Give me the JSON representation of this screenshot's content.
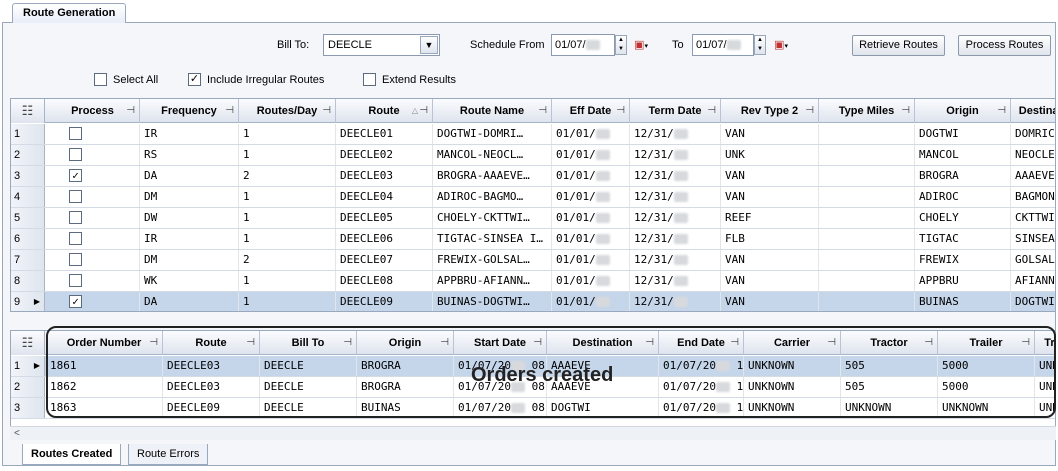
{
  "window": {
    "tab_title": "Route Generation"
  },
  "toolbar": {
    "bill_to_label": "Bill To:",
    "bill_to_value": "DEECLE",
    "schedule_from_label": "Schedule From",
    "schedule_from_value": "01/07/",
    "to_label": "To",
    "to_value": "01/07/",
    "retrieve_label": "Retrieve Routes",
    "process_label": "Process Routes"
  },
  "options": {
    "select_all": "Select All",
    "include_irregular": "Include Irregular Routes",
    "extend_results": "Extend Results"
  },
  "routes_grid": {
    "headers": [
      "Process",
      "Frequency",
      "Routes/Day",
      "Route",
      "Route Name",
      "Eff Date",
      "Term Date",
      "Rev Type 2",
      "Type Miles",
      "Origin",
      "Destinat"
    ],
    "rows": [
      {
        "n": "1",
        "checked": false,
        "freq": "IR",
        "rpd": "1",
        "route": "DEECLE01",
        "name": "DOGTWI-DOMRI…",
        "eff": "01/01/",
        "term": "12/31/",
        "rev": "VAN",
        "miles": "",
        "origin": "DOGTWI",
        "dest": "DOMRIC"
      },
      {
        "n": "2",
        "checked": false,
        "freq": "RS",
        "rpd": "1",
        "route": "DEECLE02",
        "name": "MANCOL-NEOCL…",
        "eff": "01/01/",
        "term": "12/31/",
        "rev": "UNK",
        "miles": "",
        "origin": "MANCOL",
        "dest": "NEOCLE"
      },
      {
        "n": "3",
        "checked": true,
        "freq": "DA",
        "rpd": "2",
        "route": "DEECLE03",
        "name": "BROGRA-AAAEVE…",
        "eff": "01/01/",
        "term": "12/31/",
        "rev": "VAN",
        "miles": "",
        "origin": "BROGRA",
        "dest": "AAAEVE"
      },
      {
        "n": "4",
        "checked": false,
        "freq": "DM",
        "rpd": "1",
        "route": "DEECLE04",
        "name": "ADIROC-BAGMO…",
        "eff": "01/01/",
        "term": "12/31/",
        "rev": "VAN",
        "miles": "",
        "origin": "ADIROC",
        "dest": "BAGMON"
      },
      {
        "n": "5",
        "checked": false,
        "freq": "DW",
        "rpd": "1",
        "route": "DEECLE05",
        "name": "CHOELY-CKTTWI…",
        "eff": "01/01/",
        "term": "12/31/",
        "rev": "REEF",
        "miles": "",
        "origin": "CHOELY",
        "dest": "CKTTWI"
      },
      {
        "n": "6",
        "checked": false,
        "freq": "IR",
        "rpd": "1",
        "route": "DEECLE06",
        "name": "TIGTAC-SINSEA I…",
        "eff": "01/01/",
        "term": "12/31/",
        "rev": "FLB",
        "miles": "",
        "origin": "TIGTAC",
        "dest": "SINSEA"
      },
      {
        "n": "7",
        "checked": false,
        "freq": "DM",
        "rpd": "2",
        "route": "DEECLE07",
        "name": "FREWIX-GOLSAL…",
        "eff": "01/01/",
        "term": "12/31/",
        "rev": "VAN",
        "miles": "",
        "origin": "FREWIX",
        "dest": "GOLSAL"
      },
      {
        "n": "8",
        "checked": false,
        "freq": "WK",
        "rpd": "1",
        "route": "DEECLE08",
        "name": "APPBRU-AFIANN…",
        "eff": "01/01/",
        "term": "12/31/",
        "rev": "VAN",
        "miles": "",
        "origin": "APPBRU",
        "dest": "AFIANN"
      },
      {
        "n": "9",
        "checked": true,
        "freq": "DA",
        "rpd": "1",
        "route": "DEECLE09",
        "name": "BUINAS-DOGTWI…",
        "eff": "01/01/",
        "term": "12/31/",
        "rev": "VAN",
        "miles": "",
        "origin": "BUINAS",
        "dest": "DOGTWI"
      }
    ]
  },
  "orders_grid": {
    "headers": [
      "Order Number",
      "Route",
      "Bill To",
      "Origin",
      "Start Date",
      "Destination",
      "End Date",
      "Carrier",
      "Tractor",
      "Trailer",
      "Tr"
    ],
    "rows": [
      {
        "n": "1",
        "order": "1861",
        "route": "DEECLE03",
        "billto": "DEECLE",
        "origin": "BROGRA",
        "start": "01/07/20",
        "starttime": "08:",
        "dest": "AAAEVE",
        "end": "01/07/20",
        "endtime": "1…",
        "carrier": "UNKNOWN",
        "tractor": "505",
        "trailer": "5000",
        "tr": "UNKN"
      },
      {
        "n": "2",
        "order": "1862",
        "route": "DEECLE03",
        "billto": "DEECLE",
        "origin": "BROGRA",
        "start": "01/07/20",
        "starttime": "08:",
        "dest": "AAAEVE",
        "end": "01/07/20",
        "endtime": "1…",
        "carrier": "UNKNOWN",
        "tractor": "505",
        "trailer": "5000",
        "tr": "UNKN"
      },
      {
        "n": "3",
        "order": "1863",
        "route": "DEECLE09",
        "billto": "DEECLE",
        "origin": "BUINAS",
        "start": "01/07/20",
        "starttime": "08:…",
        "dest": "DOGTWI",
        "end": "01/07/20",
        "endtime": "1…",
        "carrier": "UNKNOWN",
        "tractor": "UNKNOWN",
        "trailer": "UNKNOWN",
        "tr": "UNKN"
      }
    ]
  },
  "annotation": "Orders created",
  "bottom_tabs": [
    "Routes Created",
    "Route Errors"
  ],
  "colors": {
    "selected_row": "#c5d5ea",
    "header_bg": "#dee4ee",
    "frame_border": "#9aa8bd"
  },
  "icons": {
    "column_chooser": "column-chooser-icon",
    "pin": "pin-icon",
    "calendar": "calendar-icon"
  }
}
